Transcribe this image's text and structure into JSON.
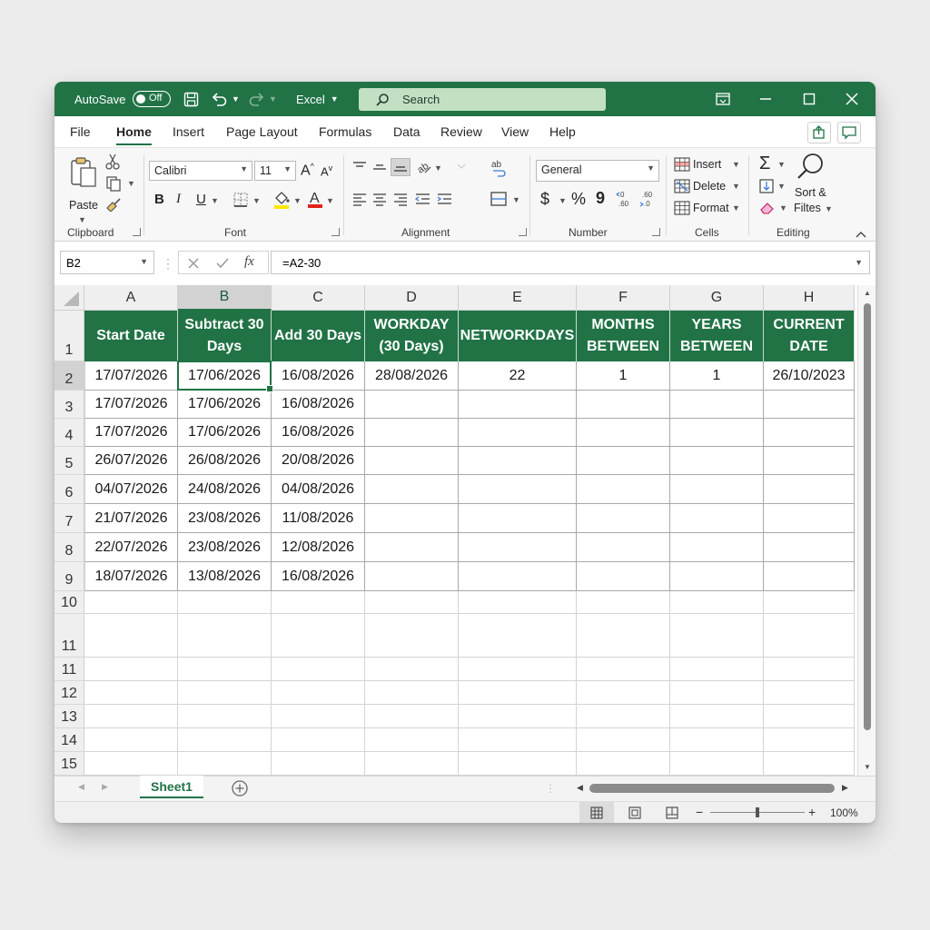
{
  "titlebar": {
    "autosave_label": "AutoSave",
    "autosave_state": "Off",
    "app_name": "Excel",
    "search_placeholder": "Search"
  },
  "menu": {
    "tabs": [
      "File",
      "Home",
      "Insert",
      "Page Layout",
      "Formulas",
      "Data",
      "Review",
      "View",
      "Help"
    ],
    "active": "Home"
  },
  "ribbon": {
    "clipboard": {
      "label": "Clipboard",
      "paste": "Paste"
    },
    "font": {
      "label": "Font",
      "family": "Calibri",
      "size": "11",
      "bold": "B",
      "italic": "I",
      "underline": "U"
    },
    "alignment": {
      "label": "Alignment"
    },
    "number": {
      "label": "Number",
      "format": "General",
      "currency": "$",
      "percent": "%",
      "comma": "9"
    },
    "cells": {
      "label": "Cells",
      "insert": "Insert",
      "delete": "Delete",
      "format": "Format"
    },
    "editing": {
      "label": "Editing",
      "sort_line1": "Sort &",
      "sort_line2": "Filtes"
    }
  },
  "formula_bar": {
    "name_box": "B2",
    "fx": "fx",
    "formula": "=A2-30"
  },
  "grid": {
    "columns": [
      "A",
      "B",
      "C",
      "D",
      "E",
      "F",
      "G",
      "H"
    ],
    "selected_column": "B",
    "row_numbers": [
      "1",
      "2",
      "3",
      "4",
      "5",
      "6",
      "7",
      "8",
      "9",
      "10",
      "11",
      "11",
      "12",
      "13",
      "14",
      "15"
    ],
    "headers": [
      [
        "Start Date"
      ],
      [
        "Subtract 30",
        "Days"
      ],
      [
        "Add 30 Days"
      ],
      [
        "WORKDAY",
        "(30 Days)"
      ],
      [
        "NETWORKDAYS"
      ],
      [
        "MONTHS",
        "BETWEEN"
      ],
      [
        "YEARS",
        "BETWEEN"
      ],
      [
        "CURRENT",
        "DATE"
      ]
    ],
    "rows": [
      [
        "17/07/2026",
        "17/06/2026",
        "16/08/2026",
        "28/08/2026",
        "22",
        "1",
        "1",
        "26/10/2023"
      ],
      [
        "17/07/2026",
        "17/06/2026",
        "16/08/2026",
        "",
        "",
        "",
        "",
        ""
      ],
      [
        "17/07/2026",
        "17/06/2026",
        "16/08/2026",
        "",
        "",
        "",
        "",
        ""
      ],
      [
        "26/07/2026",
        "26/08/2026",
        "20/08/2026",
        "",
        "",
        "",
        "",
        ""
      ],
      [
        "04/07/2026",
        "24/08/2026",
        "04/08/2026",
        "",
        "",
        "",
        "",
        ""
      ],
      [
        "21/07/2026",
        "23/08/2026",
        "11/08/2026",
        "",
        "",
        "",
        "",
        ""
      ],
      [
        "22/07/2026",
        "23/08/2026",
        "12/08/2026",
        "",
        "",
        "",
        "",
        ""
      ],
      [
        "18/07/2026",
        "13/08/2026",
        "16/08/2026",
        "",
        "",
        "",
        "",
        ""
      ]
    ],
    "selected_cell": "B2"
  },
  "sheets": {
    "tabs": [
      "Sheet1"
    ],
    "active": "Sheet1"
  },
  "status": {
    "zoom": "100%",
    "zoom_level": 0.5
  },
  "colors": {
    "accent": "#217346",
    "header_fill": "#217346",
    "search_fill": "#c3e0c4"
  }
}
